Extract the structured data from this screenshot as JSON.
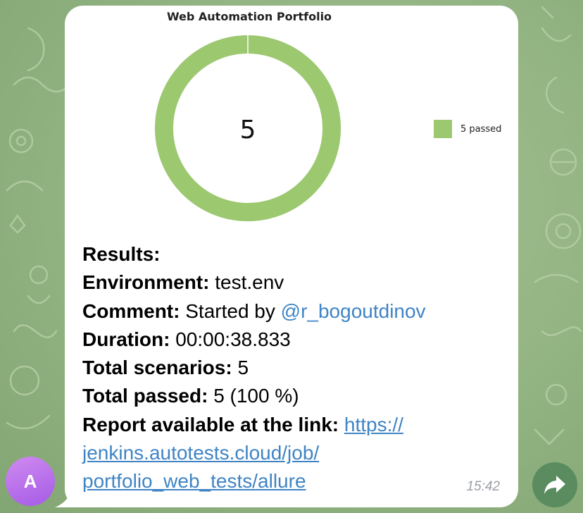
{
  "colors": {
    "chart_green": "#9cc870",
    "link": "#3f84c5",
    "avatar": "#b86ff0",
    "forward_button": "#5a8c5f"
  },
  "message": {
    "chart": {
      "title": "Web Automation Portfolio",
      "center_value": "5",
      "legend_label": "5 passed"
    },
    "results": {
      "heading": "Results:",
      "environment_label": "Environment:",
      "environment_value": "test.env",
      "comment_label": "Comment:",
      "comment_value": "Started by",
      "comment_mention": "@r_bogoutdinov",
      "duration_label": "Duration:",
      "duration_value": "00:00:38.833",
      "total_scenarios_label": "Total scenarios:",
      "total_scenarios_value": "5",
      "total_passed_label": "Total passed:",
      "total_passed_value": "5 (100 %)",
      "report_label": "Report available at the link:",
      "report_link_part1": "https://",
      "report_link_part2": "jenkins.autotests.cloud/job/",
      "report_link_part3": "portfolio_web_tests/allure"
    },
    "time": "15:42"
  },
  "avatar": {
    "initial": "A"
  },
  "icons": {
    "forward": "forward-arrow-icon"
  },
  "chart_data": {
    "type": "pie",
    "title": "Web Automation Portfolio",
    "categories": [
      "5 passed"
    ],
    "values": [
      5
    ],
    "center_label": "5",
    "legend": "right"
  }
}
